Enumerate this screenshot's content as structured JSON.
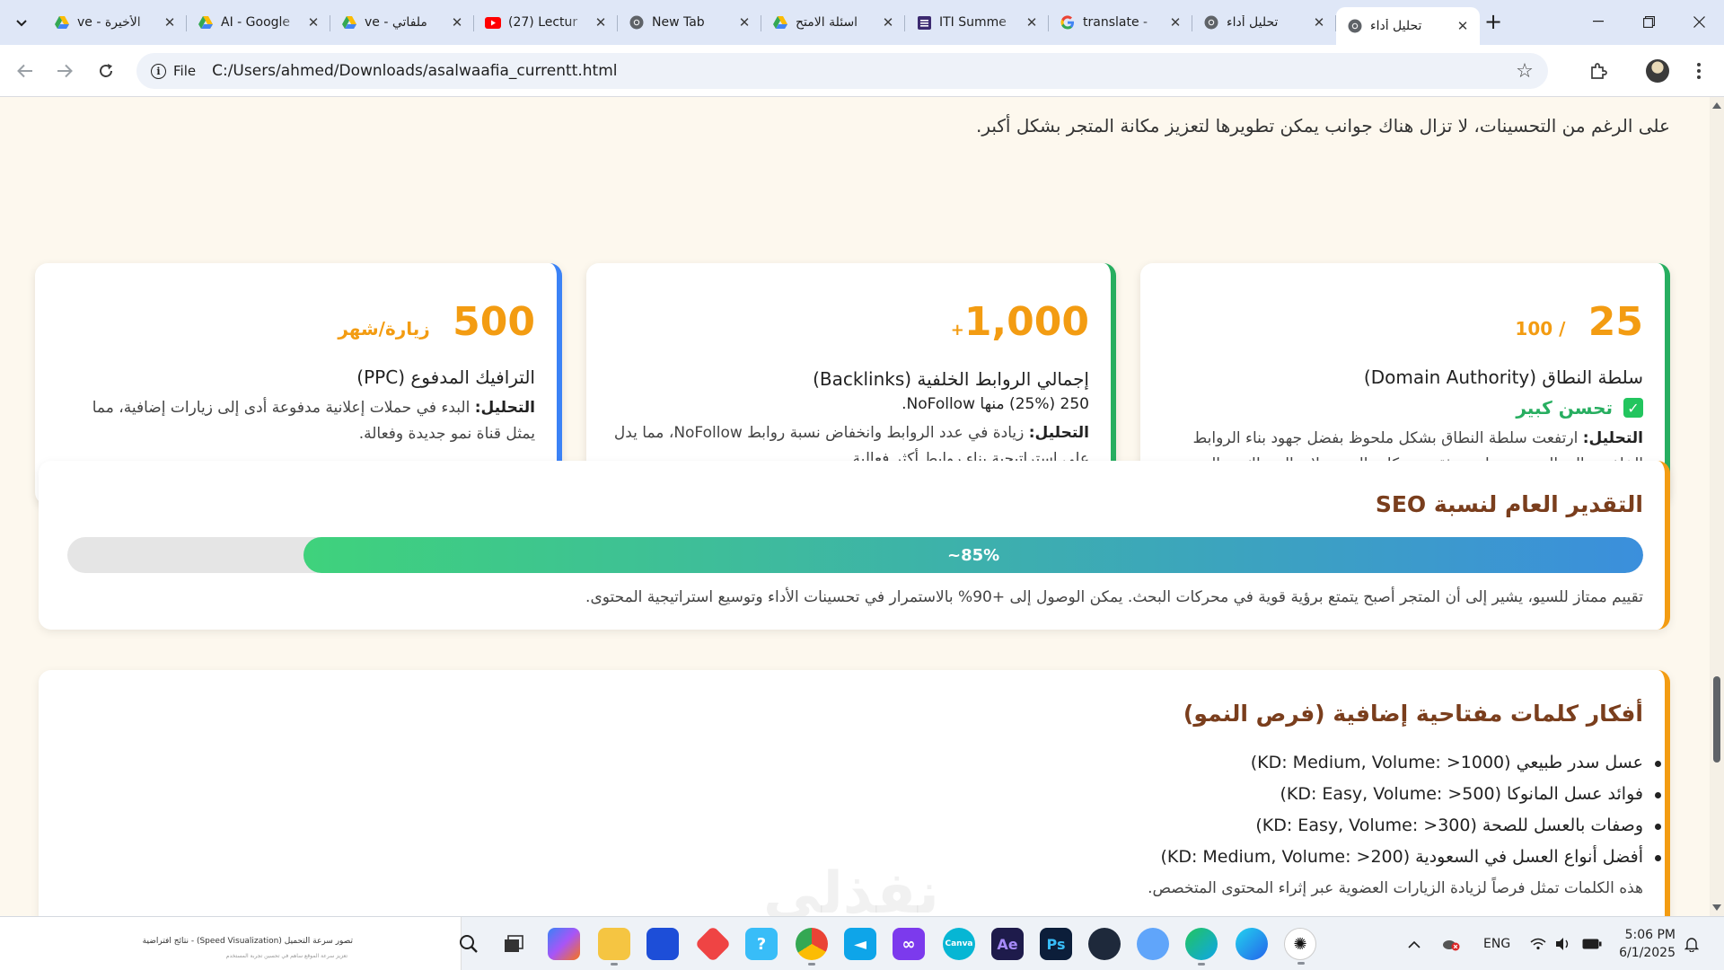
{
  "browser": {
    "tabs": [
      {
        "title": "ve - الأخيرة",
        "favicon": "google-drive-icon"
      },
      {
        "title": "AI - Google",
        "favicon": "google-drive-icon"
      },
      {
        "title": "ve - ملفاتي",
        "favicon": "google-drive-icon"
      },
      {
        "title": "(27) Lectur",
        "favicon": "youtube-icon"
      },
      {
        "title": "New Tab",
        "favicon": "chrome-icon"
      },
      {
        "title": "اسئلة الامتح",
        "favicon": "google-drive-icon"
      },
      {
        "title": "ITI Summe",
        "favicon": "form-icon"
      },
      {
        "title": "translate -",
        "favicon": "google-icon"
      },
      {
        "title": "تحليل أداء",
        "favicon": "globe-icon"
      },
      {
        "title": "تحليل أداء",
        "favicon": "globe-icon",
        "active": true
      }
    ],
    "site_chip": "File",
    "url": "C:/Users/ahmed/Downloads/asalwaafia_currentt.html"
  },
  "page": {
    "intro": "على الرغم من التحسينات، لا تزال هناك جوانب يمكن تطويرها لتعزيز مكانة المتجر بشكل أكبر.",
    "cards": {
      "domain": {
        "value": "25",
        "unit": "/ 100",
        "title": "سلطة النطاق (Domain Authority)",
        "badge": "تحسن كبير",
        "analysis_label": "التحليل:",
        "analysis": "ارتفعت سلطة النطاق بشكل ملحوظ بفضل جهود بناء الروابط الخلفية عالية الجودة، مما عزز ثقة محركات البحث. لا يزال هناك مجال للنمو."
      },
      "backlinks": {
        "value": "1,000",
        "plus": "+",
        "title": "إجمالي الروابط الخلفية (Backlinks)",
        "stat": "250 (25%) منها NoFollow.",
        "analysis_label": "التحليل:",
        "analysis": "زيادة في عدد الروابط وانخفاض نسبة روابط NoFollow، مما يدل على استراتيجية بناء روابط أكثر فعالية."
      },
      "ppc": {
        "value": "500",
        "unit": "زيارة/شهر",
        "title": "الترافيك المدفوع (PPC)",
        "analysis_label": "التحليل:",
        "analysis": "البدء في حملات إعلانية مدفوعة أدى إلى زيارات إضافية، مما يمثل قناة نمو جديدة وفعالة."
      }
    },
    "seo": {
      "title": "التقدير العام لنسبة SEO",
      "progress_label": "~85%",
      "progress_value": 0.85,
      "description": "تقييم ممتاز للسيو، يشير إلى أن المتجر أصبح يتمتع برؤية قوية في محركات البحث. يمكن الوصول إلى +90% بالاستمرار في تحسينات الأداء وتوسيع استراتيجية المحتوى."
    },
    "keywords": {
      "title": "أفكار كلمات مفتاحية إضافية (فرص النمو)",
      "items": [
        "عسل سدر طبيعي (KD: Medium, Volume: >1000)",
        "فوائد عسل المانوكا (KD: Easy, Volume: >500)",
        "وصفات بالعسل للصحة (KD: Easy, Volume: >300)",
        "أفضل أنواع العسل في السعودية (KD: Medium, Volume: >200)"
      ],
      "note": "هذه الكلمات تمثل فرصاً لزيادة الزيارات العضوية عبر إثراء المحتوى المتخصص."
    },
    "watermark": "نفذلي"
  },
  "taskbar": {
    "preview_title": "تصور سرعة التحميل (Speed Visualization) - نتائج افتراضية",
    "preview_sub": "تعزيز سرعة الموقع ساهم في تحسين تجربة المستخدم",
    "language": "ENG",
    "time": "5:06 PM",
    "date": "6/1/2025"
  },
  "colors": {
    "accent_orange": "#f39c12",
    "green": "#27ae60",
    "blue": "#3b82f6",
    "title_brown": "#7a3e1d",
    "page_bg": "#fdf8ee"
  }
}
